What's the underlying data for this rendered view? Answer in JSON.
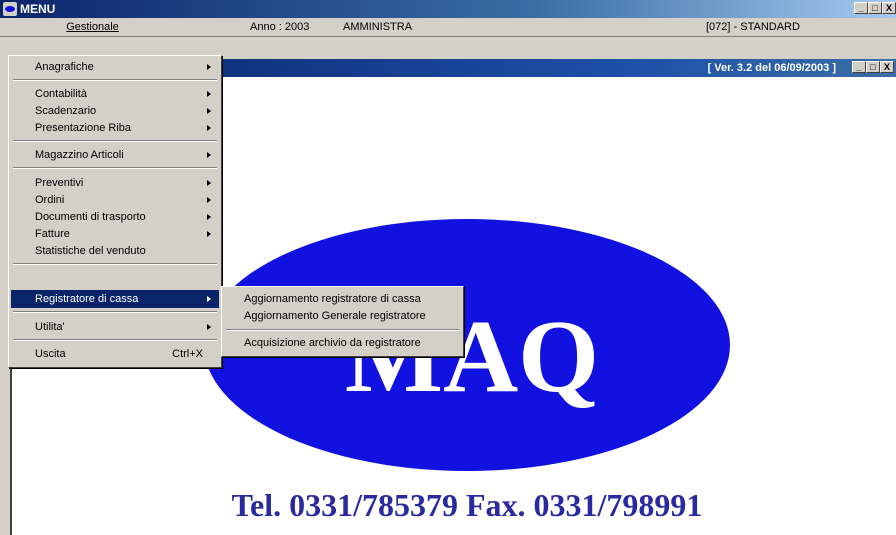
{
  "app": {
    "title": "MENU"
  },
  "menubar": {
    "gestionale": "Gestionale",
    "anno": "Anno : 2003",
    "user": "AMMINISTRA",
    "company": "[072] -  STANDARD"
  },
  "window_buttons": {
    "minimize": "_",
    "maximize": "□",
    "close": "X"
  },
  "mdi": {
    "version": "[ Ver. 3.2 del 06/09/2003 ]",
    "logo_text": "MAQ",
    "contact": "Tel. 0331/785379 Fax. 0331/798991",
    "logo_fill": "#1111e0",
    "contact_color": "#2a2aa0"
  },
  "menu": {
    "items": [
      {
        "label": "Anagrafiche",
        "submenu": true
      },
      {
        "label": "Contabilità",
        "submenu": true
      },
      {
        "label": "Scadenzario",
        "submenu": true
      },
      {
        "label": "Presentazione Riba",
        "submenu": true
      },
      {
        "label": "Magazzino Articoli",
        "submenu": true
      },
      {
        "label": "Preventivi",
        "submenu": true
      },
      {
        "label": "Ordini",
        "submenu": true
      },
      {
        "label": "Documenti di trasporto",
        "submenu": true
      },
      {
        "label": "Fatture",
        "submenu": true
      },
      {
        "label": "Statistiche del venduto",
        "submenu": false
      },
      {
        "label": "Registratore di cassa",
        "submenu": true,
        "highlighted": true
      },
      {
        "label": "Utilita'",
        "submenu": true
      },
      {
        "label": "Uscita",
        "shortcut": "Ctrl+X"
      }
    ]
  },
  "submenu": {
    "items": [
      {
        "label": "Aggiornamento registratore di cassa"
      },
      {
        "label": "Aggiornamento Generale registratore"
      },
      {
        "label": "Acquisizione archivio da registratore"
      }
    ]
  },
  "colors": {
    "titlebar": "#0a246a",
    "highlight": "#0a246a",
    "face": "#d4d0c8"
  }
}
